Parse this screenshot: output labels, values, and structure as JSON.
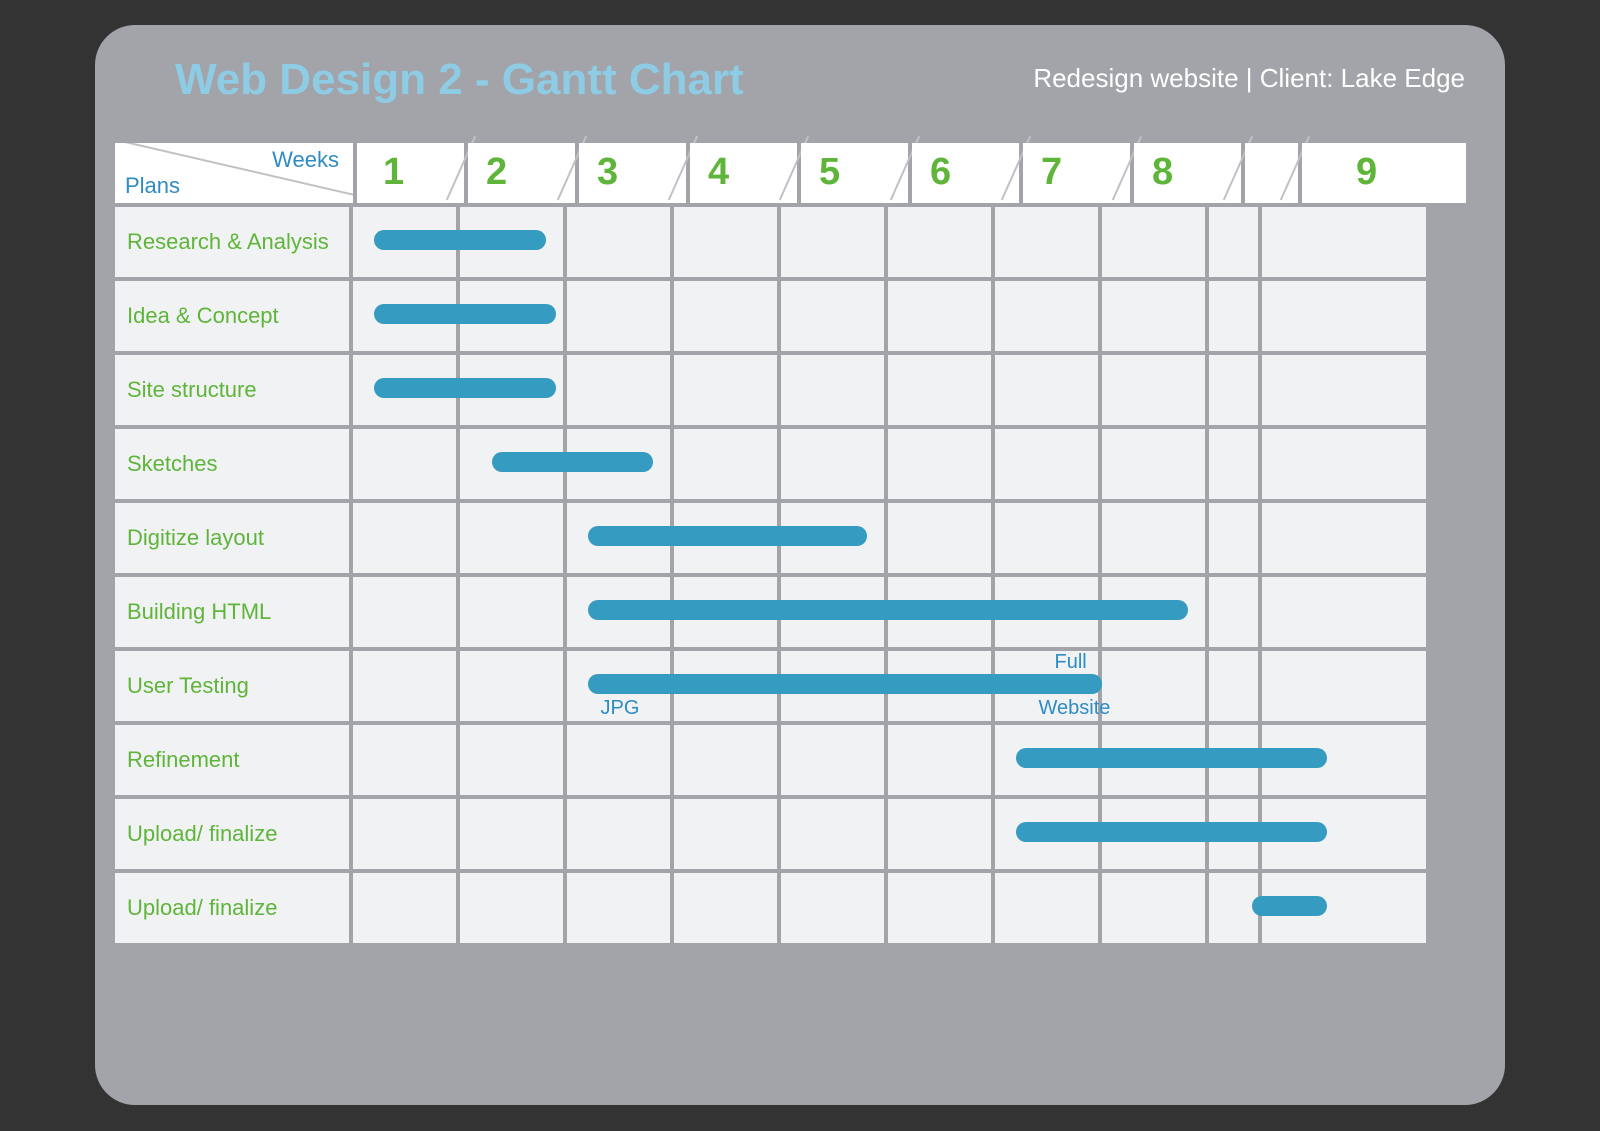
{
  "header": {
    "title": "Web Design 2 - Gantt Chart",
    "subtitle": "Redesign website | Client: Lake Edge"
  },
  "axis": {
    "weeks_label": "Weeks",
    "plans_label": "Plans",
    "weeks": [
      "1",
      "2",
      "3",
      "4",
      "5",
      "6",
      "7",
      "8",
      "9"
    ]
  },
  "tasks": [
    {
      "label": "Research & Analysis"
    },
    {
      "label": "Idea & Concept"
    },
    {
      "label": "Site structure"
    },
    {
      "label": "Sketches"
    },
    {
      "label": "Digitize layout"
    },
    {
      "label": "Building HTML"
    },
    {
      "label": "User Testing"
    },
    {
      "label": "Refinement"
    },
    {
      "label": "Upload/ finalize"
    },
    {
      "label": "Upload/ finalize"
    }
  ],
  "annotations": {
    "jpg": "JPG",
    "full": "Full",
    "website": "Website"
  },
  "chart_data": {
    "type": "bar",
    "orientation": "gantt",
    "x_unit": "weeks",
    "x_range": [
      0.5,
      9.5
    ],
    "categories": [
      "Research & Analysis",
      "Idea & Concept",
      "Site structure",
      "Sketches",
      "Digitize layout",
      "Building HTML",
      "User Testing",
      "Refinement",
      "Upload/ finalize",
      "Upload/ finalize"
    ],
    "series": [
      {
        "name": "duration",
        "values": [
          {
            "start": 0.7,
            "end": 2.3
          },
          {
            "start": 0.7,
            "end": 2.4
          },
          {
            "start": 0.7,
            "end": 2.4
          },
          {
            "start": 1.8,
            "end": 3.3
          },
          {
            "start": 2.7,
            "end": 5.3
          },
          {
            "start": 2.7,
            "end": 8.3
          },
          {
            "start": 2.7,
            "end": 7.5
          },
          {
            "start": 6.7,
            "end": 9.6
          },
          {
            "start": 6.7,
            "end": 9.6
          },
          {
            "start": 8.9,
            "end": 9.6
          }
        ]
      }
    ],
    "annotations": [
      {
        "row": "User Testing",
        "x": 3.0,
        "text": "JPG",
        "pos": "below"
      },
      {
        "row": "User Testing",
        "x": 7.0,
        "text": "Full",
        "pos": "above"
      },
      {
        "row": "User Testing",
        "x": 7.0,
        "text": "Website",
        "pos": "below"
      }
    ],
    "title": "Web Design 2 - Gantt Chart",
    "xlabel": "Weeks",
    "ylabel": "Plans"
  }
}
